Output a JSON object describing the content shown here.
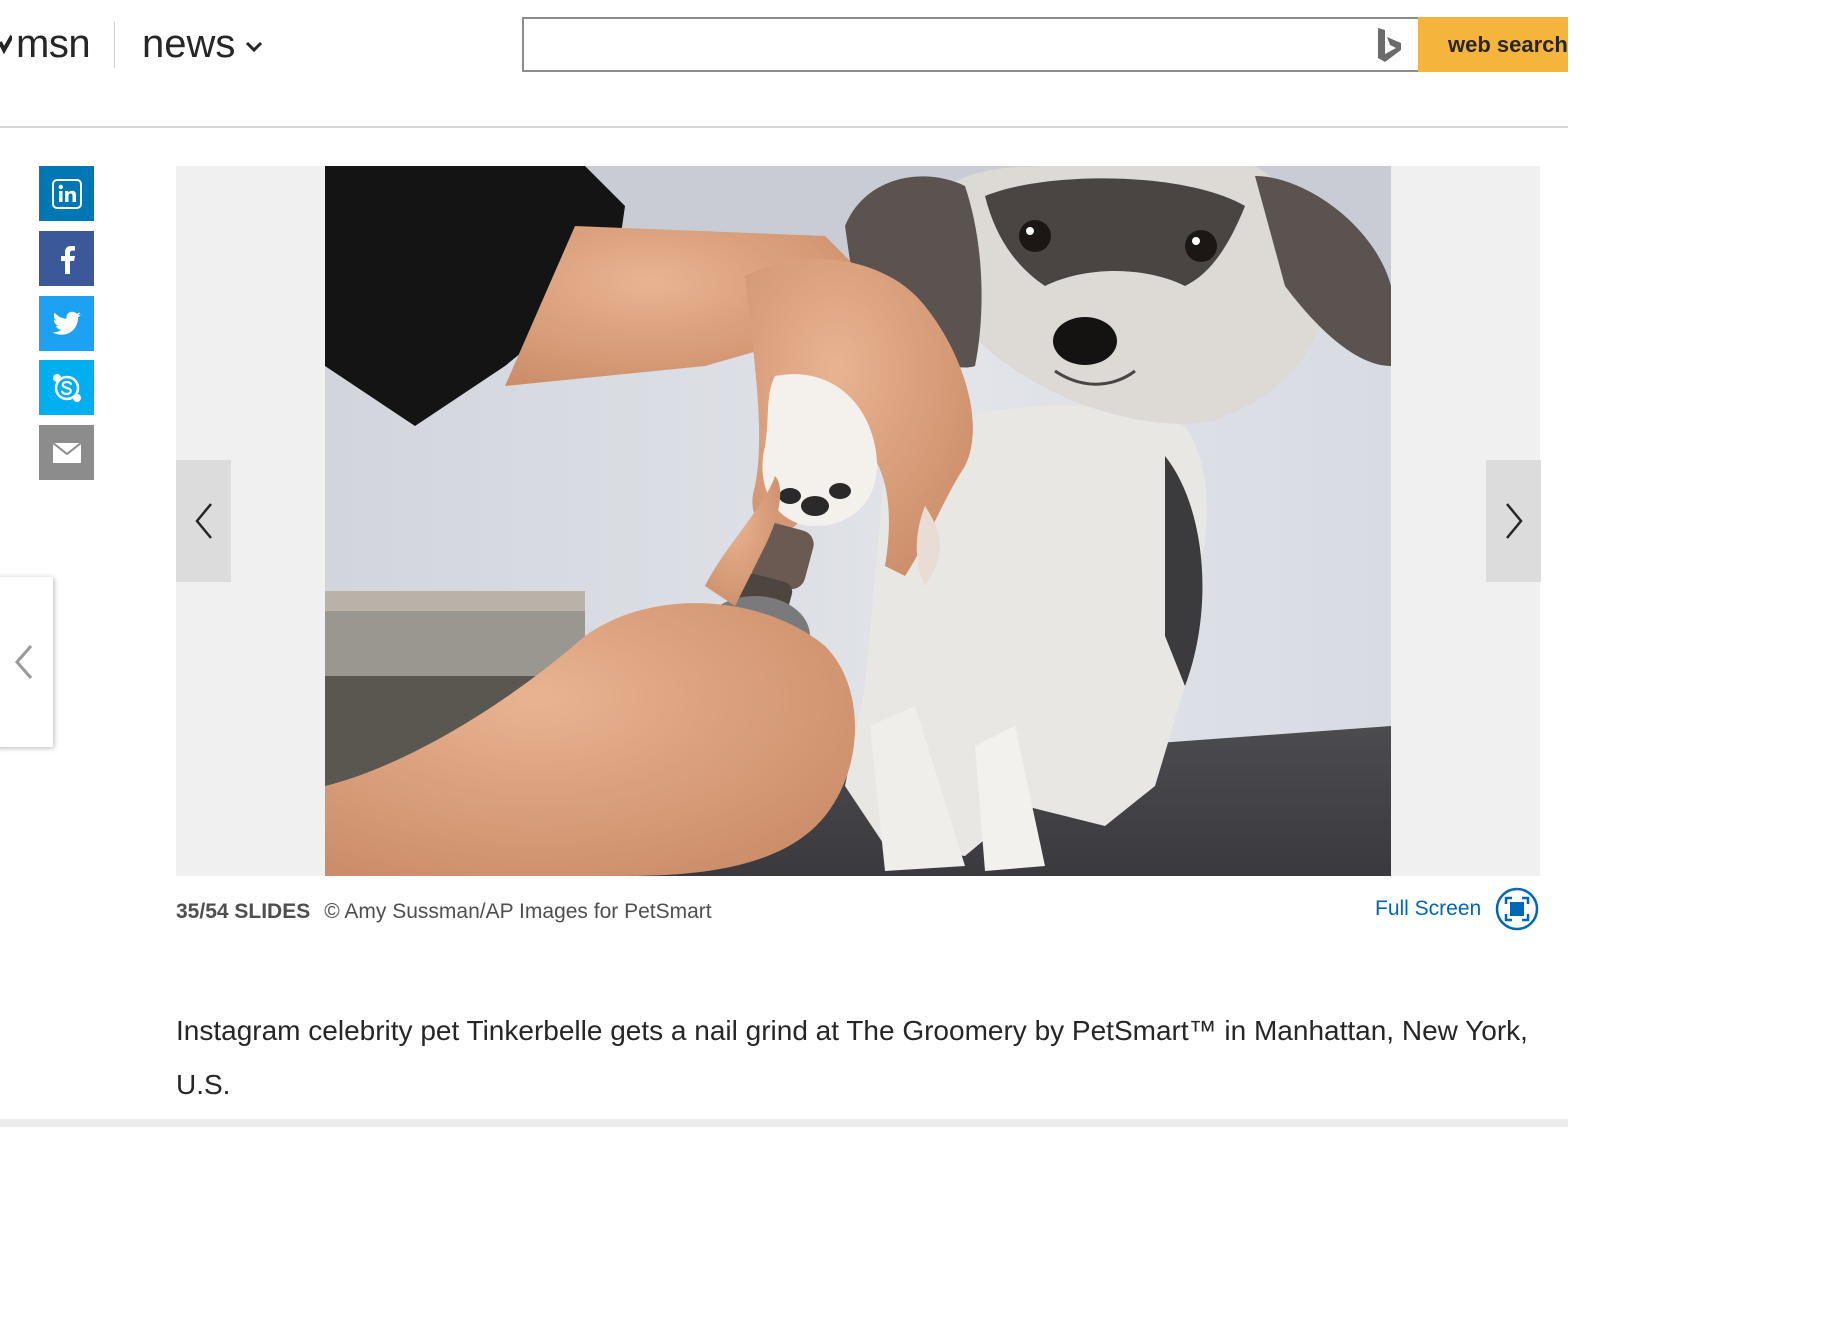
{
  "header": {
    "logo_text": "msn",
    "section_label": "news",
    "search": {
      "value": "",
      "placeholder": "",
      "button_label": "web search"
    }
  },
  "share": {
    "icons": [
      "linkedin-icon",
      "facebook-icon",
      "twitter-icon",
      "skype-icon",
      "email-icon"
    ],
    "colors": {
      "linkedin": "#0077b5",
      "facebook": "#3b5998",
      "twitter": "#1da1f2",
      "skype": "#00aff0",
      "email": "#8c8c8c"
    }
  },
  "slideshow": {
    "counter": "35/54 SLIDES",
    "credit": "© Amy Sussman/AP Images for PetSmart",
    "fullscreen_label": "Full Screen",
    "caption": "Instagram celebrity pet Tinkerbelle gets a nail grind at The Groomery by PetSmart™ in Manhattan, New York, U.S."
  },
  "colors": {
    "accent_button": "#f5b53d",
    "link_blue": "#0067b8"
  }
}
